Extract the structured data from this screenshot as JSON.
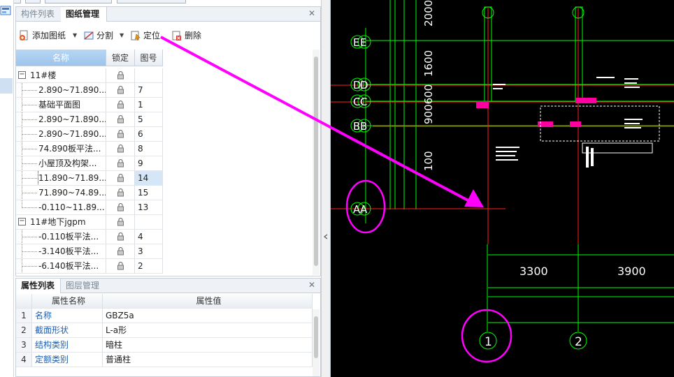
{
  "top_panel": {
    "tabs": [
      "构件列表",
      "图纸管理"
    ],
    "toolbar": {
      "add_drawing": "添加图纸",
      "split": "分割",
      "locate": "定位",
      "delete": "删除"
    },
    "columns": {
      "name": "名称",
      "lock": "锁定",
      "number": "图号"
    },
    "rows": [
      {
        "name": "11#楼",
        "num": "",
        "group": true
      },
      {
        "name": "2.890~71.890...",
        "num": "7"
      },
      {
        "name": "基础平面图",
        "num": "1"
      },
      {
        "name": "2.890~71.890...",
        "num": "5"
      },
      {
        "name": "2.890~71.890...",
        "num": "6"
      },
      {
        "name": "74.890板平法...",
        "num": "8"
      },
      {
        "name": "小屋顶及构架...",
        "num": "9"
      },
      {
        "name": "11.890~71.89...",
        "num": "14",
        "selected": true
      },
      {
        "name": "71.890~74.89...",
        "num": "15"
      },
      {
        "name": "-0.110~11.89...",
        "num": "13"
      },
      {
        "name": "11#地下jgpm",
        "num": "",
        "group": true
      },
      {
        "name": "-0.110板平法...",
        "num": "4"
      },
      {
        "name": "-3.140板平法...",
        "num": "3"
      },
      {
        "name": "-6.140板平法...",
        "num": "2"
      }
    ]
  },
  "bottom_panel": {
    "tabs": [
      "属性列表",
      "图层管理"
    ],
    "columns": {
      "key": "属性名称",
      "value": "属性值"
    },
    "rows": [
      {
        "idx": "1",
        "key": "名称",
        "value": "GBZ5a"
      },
      {
        "idx": "2",
        "key": "截面形状",
        "value": "L-a形"
      },
      {
        "idx": "3",
        "key": "结构类别",
        "value": "暗柱"
      },
      {
        "idx": "4",
        "key": "定额类别",
        "value": "普通柱"
      }
    ]
  },
  "cad": {
    "axis_labels_left": [
      "E",
      "E",
      "D",
      "D",
      "C",
      "C",
      "B",
      "B",
      "A",
      "A"
    ],
    "axis_labels_bottom": [
      "1",
      "2"
    ],
    "vertical_dims": [
      "2000",
      "1600",
      "900600",
      "100"
    ],
    "horizontal_dims": [
      "3300",
      "3900"
    ],
    "colors": {
      "background": "#000000",
      "grid": "#00ff00",
      "axis_line": "#ff0000",
      "annotation": "#ff00ff",
      "text": "#ffffff"
    }
  }
}
